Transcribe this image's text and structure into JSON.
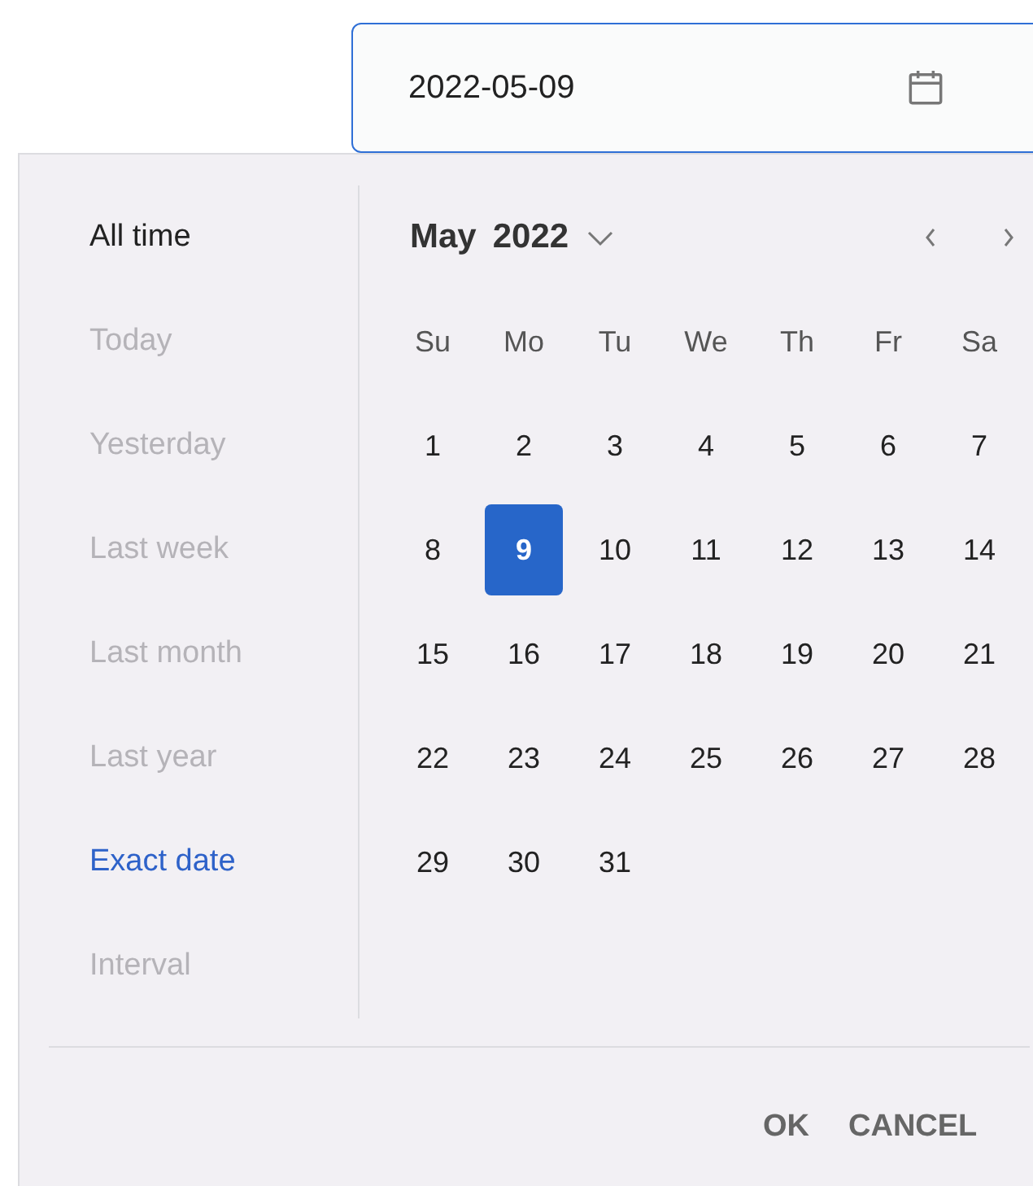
{
  "date_field": {
    "value": "2022-05-09"
  },
  "presets": [
    {
      "label": "All time",
      "selected": false,
      "disabled": false
    },
    {
      "label": "Today",
      "selected": false,
      "disabled": true
    },
    {
      "label": "Yesterday",
      "selected": false,
      "disabled": true
    },
    {
      "label": "Last week",
      "selected": false,
      "disabled": true
    },
    {
      "label": "Last month",
      "selected": false,
      "disabled": true
    },
    {
      "label": "Last year",
      "selected": false,
      "disabled": true
    },
    {
      "label": "Exact date",
      "selected": true,
      "disabled": false
    },
    {
      "label": "Interval",
      "selected": false,
      "disabled": true
    }
  ],
  "calendar": {
    "month": "May",
    "year": "2022",
    "weekdays": [
      "Su",
      "Mo",
      "Tu",
      "We",
      "Th",
      "Fr",
      "Sa"
    ],
    "weeks": [
      [
        {
          "label": "1",
          "selected": false
        },
        {
          "label": "2",
          "selected": false
        },
        {
          "label": "3",
          "selected": false
        },
        {
          "label": "4",
          "selected": false
        },
        {
          "label": "5",
          "selected": false
        },
        {
          "label": "6",
          "selected": false
        },
        {
          "label": "7",
          "selected": false
        }
      ],
      [
        {
          "label": "8",
          "selected": false
        },
        {
          "label": "9",
          "selected": true
        },
        {
          "label": "10",
          "selected": false
        },
        {
          "label": "11",
          "selected": false
        },
        {
          "label": "12",
          "selected": false
        },
        {
          "label": "13",
          "selected": false
        },
        {
          "label": "14",
          "selected": false
        }
      ],
      [
        {
          "label": "15",
          "selected": false
        },
        {
          "label": "16",
          "selected": false
        },
        {
          "label": "17",
          "selected": false
        },
        {
          "label": "18",
          "selected": false
        },
        {
          "label": "19",
          "selected": false
        },
        {
          "label": "20",
          "selected": false
        },
        {
          "label": "21",
          "selected": false
        }
      ],
      [
        {
          "label": "22",
          "selected": false
        },
        {
          "label": "23",
          "selected": false
        },
        {
          "label": "24",
          "selected": false
        },
        {
          "label": "25",
          "selected": false
        },
        {
          "label": "26",
          "selected": false
        },
        {
          "label": "27",
          "selected": false
        },
        {
          "label": "28",
          "selected": false
        }
      ],
      [
        {
          "label": "29",
          "selected": false
        },
        {
          "label": "30",
          "selected": false
        },
        {
          "label": "31",
          "selected": false
        }
      ]
    ]
  },
  "buttons": [
    "OK",
    "CANCEL"
  ]
}
